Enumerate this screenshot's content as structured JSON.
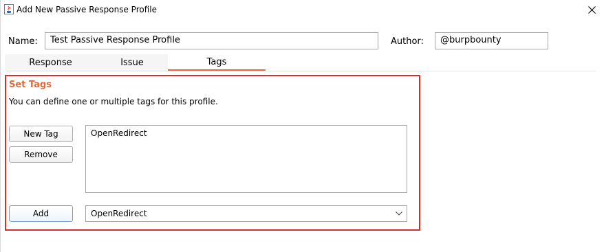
{
  "window": {
    "title": "Add New Passive Response Profile",
    "icon": "java-icon"
  },
  "header": {
    "name_label": "Name:",
    "name_value": "Test Passive Response Profile",
    "author_label": "Author:",
    "author_value": "@burpbounty"
  },
  "tabs": [
    {
      "label": "Response",
      "active": false
    },
    {
      "label": "Issue",
      "active": false
    },
    {
      "label": "Tags",
      "active": true
    }
  ],
  "tags_panel": {
    "title": "Set Tags",
    "description": "You can define one or multiple tags for this profile.",
    "new_tag_label": "New Tag",
    "remove_label": "Remove",
    "add_label": "Add",
    "tags": [
      "OpenRedirect"
    ],
    "selected_tag": "OpenRedirect"
  },
  "colors": {
    "accent": "#e06a3b",
    "highlight_border": "#d32f2f"
  }
}
